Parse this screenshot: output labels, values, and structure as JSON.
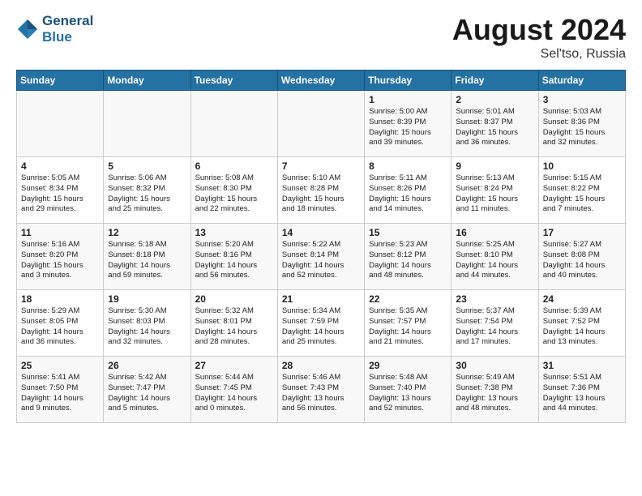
{
  "header": {
    "logo_line1": "General",
    "logo_line2": "Blue",
    "month_year": "August 2024",
    "location": "Sel'tso, Russia"
  },
  "days_of_week": [
    "Sunday",
    "Monday",
    "Tuesday",
    "Wednesday",
    "Thursday",
    "Friday",
    "Saturday"
  ],
  "weeks": [
    [
      {
        "num": "",
        "info": ""
      },
      {
        "num": "",
        "info": ""
      },
      {
        "num": "",
        "info": ""
      },
      {
        "num": "",
        "info": ""
      },
      {
        "num": "1",
        "info": "Sunrise: 5:00 AM\nSunset: 8:39 PM\nDaylight: 15 hours\nand 39 minutes."
      },
      {
        "num": "2",
        "info": "Sunrise: 5:01 AM\nSunset: 8:37 PM\nDaylight: 15 hours\nand 36 minutes."
      },
      {
        "num": "3",
        "info": "Sunrise: 5:03 AM\nSunset: 8:36 PM\nDaylight: 15 hours\nand 32 minutes."
      }
    ],
    [
      {
        "num": "4",
        "info": "Sunrise: 5:05 AM\nSunset: 8:34 PM\nDaylight: 15 hours\nand 29 minutes."
      },
      {
        "num": "5",
        "info": "Sunrise: 5:06 AM\nSunset: 8:32 PM\nDaylight: 15 hours\nand 25 minutes."
      },
      {
        "num": "6",
        "info": "Sunrise: 5:08 AM\nSunset: 8:30 PM\nDaylight: 15 hours\nand 22 minutes."
      },
      {
        "num": "7",
        "info": "Sunrise: 5:10 AM\nSunset: 8:28 PM\nDaylight: 15 hours\nand 18 minutes."
      },
      {
        "num": "8",
        "info": "Sunrise: 5:11 AM\nSunset: 8:26 PM\nDaylight: 15 hours\nand 14 minutes."
      },
      {
        "num": "9",
        "info": "Sunrise: 5:13 AM\nSunset: 8:24 PM\nDaylight: 15 hours\nand 11 minutes."
      },
      {
        "num": "10",
        "info": "Sunrise: 5:15 AM\nSunset: 8:22 PM\nDaylight: 15 hours\nand 7 minutes."
      }
    ],
    [
      {
        "num": "11",
        "info": "Sunrise: 5:16 AM\nSunset: 8:20 PM\nDaylight: 15 hours\nand 3 minutes."
      },
      {
        "num": "12",
        "info": "Sunrise: 5:18 AM\nSunset: 8:18 PM\nDaylight: 14 hours\nand 59 minutes."
      },
      {
        "num": "13",
        "info": "Sunrise: 5:20 AM\nSunset: 8:16 PM\nDaylight: 14 hours\nand 56 minutes."
      },
      {
        "num": "14",
        "info": "Sunrise: 5:22 AM\nSunset: 8:14 PM\nDaylight: 14 hours\nand 52 minutes."
      },
      {
        "num": "15",
        "info": "Sunrise: 5:23 AM\nSunset: 8:12 PM\nDaylight: 14 hours\nand 48 minutes."
      },
      {
        "num": "16",
        "info": "Sunrise: 5:25 AM\nSunset: 8:10 PM\nDaylight: 14 hours\nand 44 minutes."
      },
      {
        "num": "17",
        "info": "Sunrise: 5:27 AM\nSunset: 8:08 PM\nDaylight: 14 hours\nand 40 minutes."
      }
    ],
    [
      {
        "num": "18",
        "info": "Sunrise: 5:29 AM\nSunset: 8:05 PM\nDaylight: 14 hours\nand 36 minutes."
      },
      {
        "num": "19",
        "info": "Sunrise: 5:30 AM\nSunset: 8:03 PM\nDaylight: 14 hours\nand 32 minutes."
      },
      {
        "num": "20",
        "info": "Sunrise: 5:32 AM\nSunset: 8:01 PM\nDaylight: 14 hours\nand 28 minutes."
      },
      {
        "num": "21",
        "info": "Sunrise: 5:34 AM\nSunset: 7:59 PM\nDaylight: 14 hours\nand 25 minutes."
      },
      {
        "num": "22",
        "info": "Sunrise: 5:35 AM\nSunset: 7:57 PM\nDaylight: 14 hours\nand 21 minutes."
      },
      {
        "num": "23",
        "info": "Sunrise: 5:37 AM\nSunset: 7:54 PM\nDaylight: 14 hours\nand 17 minutes."
      },
      {
        "num": "24",
        "info": "Sunrise: 5:39 AM\nSunset: 7:52 PM\nDaylight: 14 hours\nand 13 minutes."
      }
    ],
    [
      {
        "num": "25",
        "info": "Sunrise: 5:41 AM\nSunset: 7:50 PM\nDaylight: 14 hours\nand 9 minutes."
      },
      {
        "num": "26",
        "info": "Sunrise: 5:42 AM\nSunset: 7:47 PM\nDaylight: 14 hours\nand 5 minutes."
      },
      {
        "num": "27",
        "info": "Sunrise: 5:44 AM\nSunset: 7:45 PM\nDaylight: 14 hours\nand 0 minutes."
      },
      {
        "num": "28",
        "info": "Sunrise: 5:46 AM\nSunset: 7:43 PM\nDaylight: 13 hours\nand 56 minutes."
      },
      {
        "num": "29",
        "info": "Sunrise: 5:48 AM\nSunset: 7:40 PM\nDaylight: 13 hours\nand 52 minutes."
      },
      {
        "num": "30",
        "info": "Sunrise: 5:49 AM\nSunset: 7:38 PM\nDaylight: 13 hours\nand 48 minutes."
      },
      {
        "num": "31",
        "info": "Sunrise: 5:51 AM\nSunset: 7:36 PM\nDaylight: 13 hours\nand 44 minutes."
      }
    ]
  ]
}
